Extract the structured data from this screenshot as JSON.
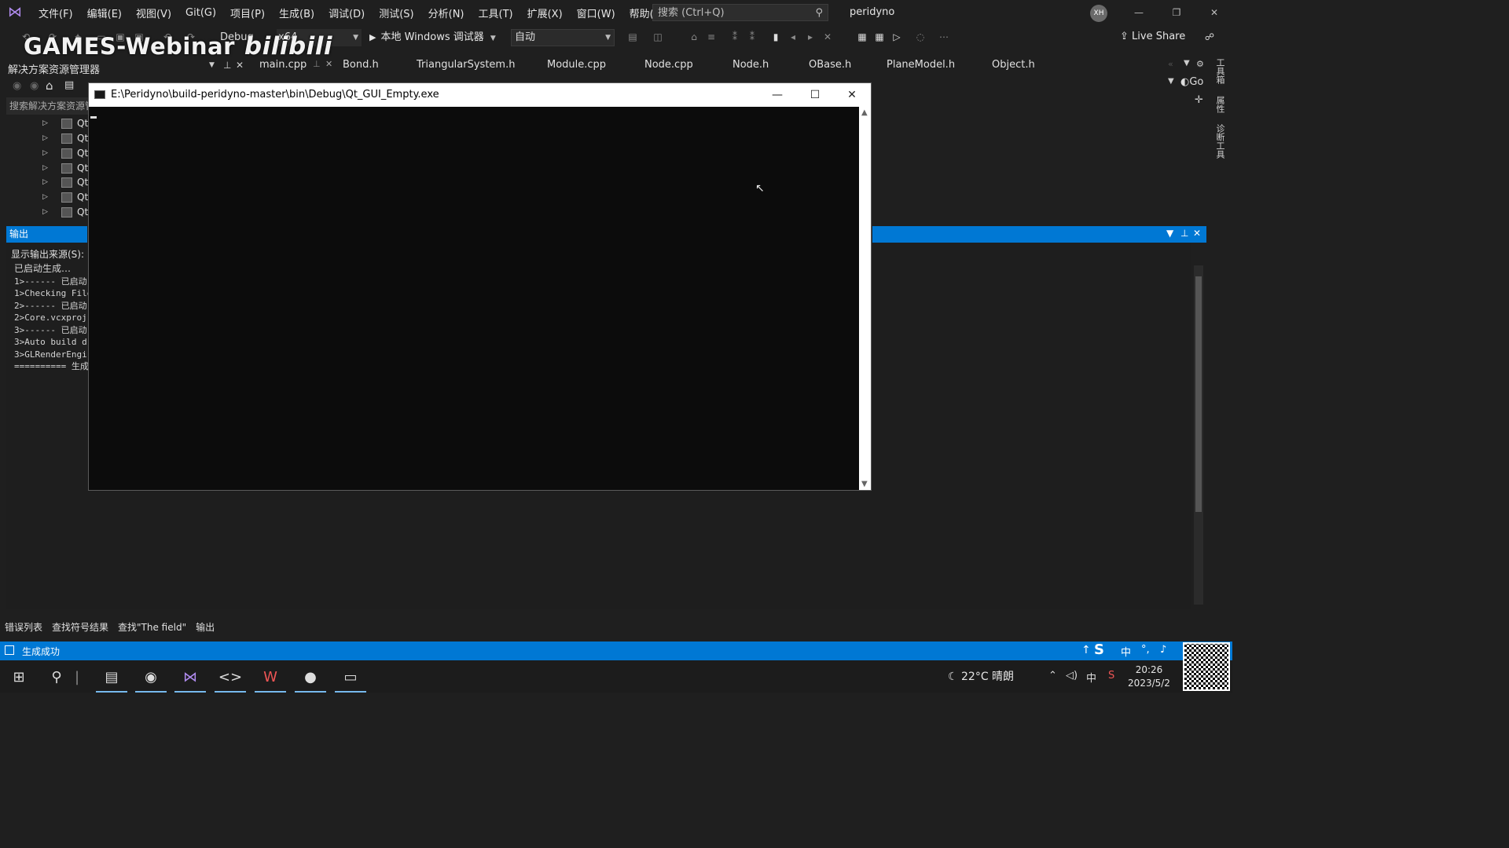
{
  "menubar": {
    "items": [
      "文件(F)",
      "编辑(E)",
      "视图(V)",
      "Git(G)",
      "项目(P)",
      "生成(B)",
      "调试(D)",
      "测试(S)",
      "分析(N)",
      "工具(T)",
      "扩展(X)",
      "窗口(W)",
      "帮助(H)"
    ],
    "search_placeholder": "搜索 (Ctrl+Q)",
    "solution_name": "peridyno",
    "avatar_initials": "XH"
  },
  "toolbar": {
    "configuration": "Debug",
    "platform": "x64",
    "run_label": "本地 Windows 调试器",
    "auto_label": "自动",
    "live_share": "Live Share"
  },
  "watermark": {
    "games": "GAMES-Webinar",
    "bili": "bilibili"
  },
  "solution_explorer": {
    "title": "解决方案资源管理器",
    "search_placeholder": "搜索解决方案资源管理器",
    "items": [
      "Qt",
      "Qt",
      "Qt",
      "Qt",
      "Qt",
      "Qt",
      "Qt"
    ]
  },
  "tabs": [
    "main.cpp",
    "Bond.h",
    "TriangularSystem.h",
    "Module.cpp",
    "Node.cpp",
    "Node.h",
    "OBase.h",
    "PlaneModel.h",
    "Object.h"
  ],
  "editor_nav": {
    "go_label": "Go"
  },
  "right_strip": [
    "工具箱",
    "属性",
    "诊断工具"
  ],
  "output": {
    "title": "输出",
    "source_label": "显示输出来源(S):",
    "lines": [
      "已启动生成…",
      "1>------ 已启动",
      "1>Checking File",
      "2>------ 已启动",
      "2>Core.vcxproj",
      "3>------ 已启动",
      "3>Auto build d",
      "3>GLRenderEngi",
      "========== 生成"
    ]
  },
  "bottom_tabs": [
    "错误列表",
    "查找符号结果",
    "查找\"The field\"",
    "输出"
  ],
  "status": {
    "text": "生成成功"
  },
  "console": {
    "title": "E:\\Peridyno\\build-peridyno-master\\bin\\Debug\\Qt_GUI_Empty.exe"
  },
  "taskbar": {
    "weather": "22°C  晴朗",
    "time": "20:26",
    "date": "2023/5/2",
    "ime": "中"
  }
}
